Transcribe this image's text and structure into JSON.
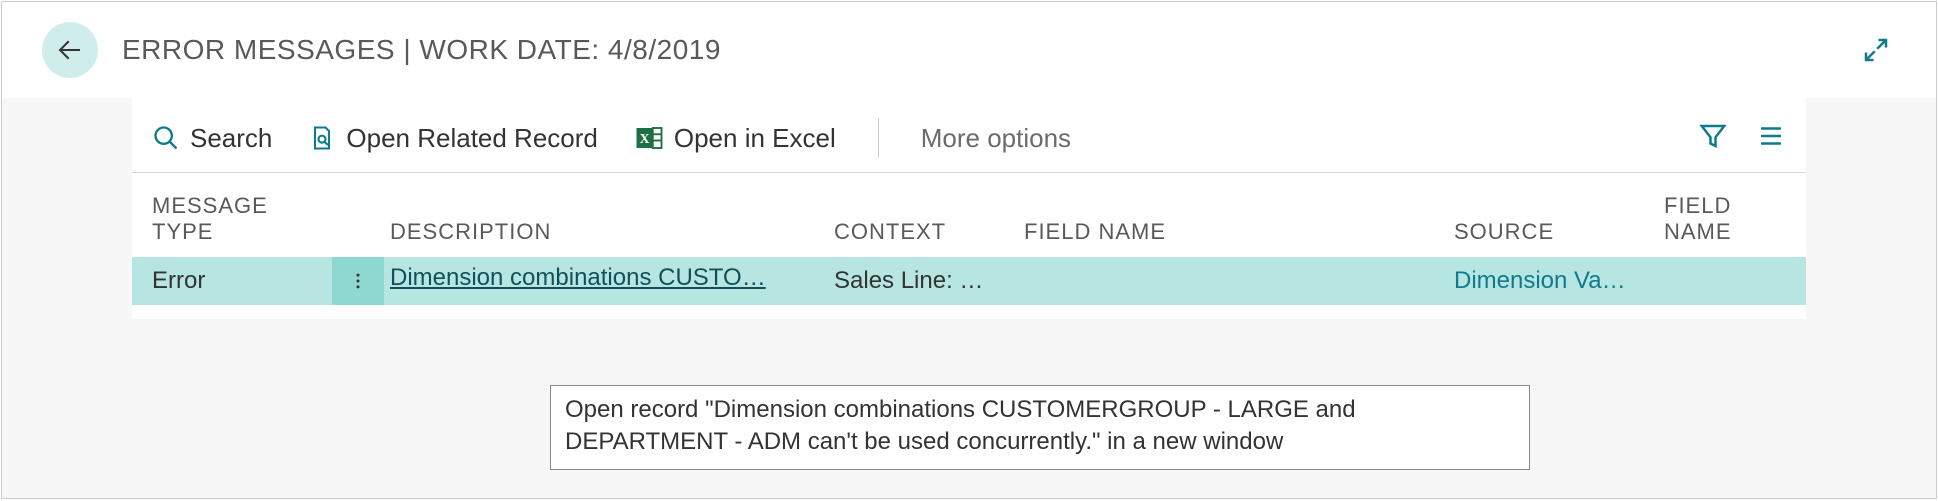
{
  "header": {
    "title": "ERROR MESSAGES | WORK DATE: 4/8/2019"
  },
  "toolbar": {
    "search_label": "Search",
    "open_related_label": "Open Related Record",
    "open_excel_label": "Open in Excel",
    "more_options_label": "More options"
  },
  "table": {
    "columns": {
      "message_type": "MESSAGE\nTYPE",
      "description": "DESCRIPTION",
      "context": "CONTEXT",
      "field_name_1": "FIELD NAME",
      "source": "SOURCE",
      "field_name_2": "FIELD NAME"
    },
    "rows": [
      {
        "message_type": "Error",
        "description": "Dimension combinations CUSTO…",
        "context": "Sales Line: …",
        "field_name_1": "",
        "source": "Dimension Va…",
        "field_name_2": ""
      }
    ]
  },
  "tooltip": {
    "text": "Open record \"Dimension combinations CUSTOMERGROUP - LARGE and DEPARTMENT - ADM can't be used concurrently.\" in a new window"
  }
}
